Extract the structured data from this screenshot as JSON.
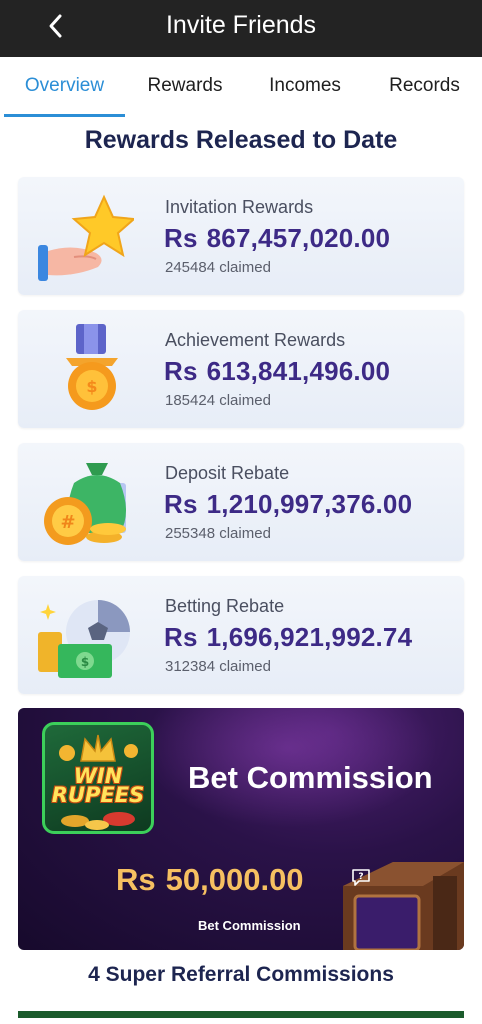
{
  "header": {
    "title": "Invite Friends"
  },
  "tabs": [
    {
      "label": "Overview",
      "active": true
    },
    {
      "label": "Rewards",
      "active": false
    },
    {
      "label": "Incomes",
      "active": false
    },
    {
      "label": "Records",
      "active": false
    }
  ],
  "section_title": "Rewards Released to Date",
  "cards": [
    {
      "label": "Invitation Rewards",
      "currency": "Rs",
      "amount": "867,457,020.00",
      "claimed": "245484 claimed",
      "icon": "star-hand-icon"
    },
    {
      "label": "Achievement Rewards",
      "currency": "Rs",
      "amount": "613,841,496.00",
      "claimed": "185424 claimed",
      "icon": "medal-icon"
    },
    {
      "label": "Deposit Rebate",
      "currency": "Rs",
      "amount": "1,210,997,376.00",
      "claimed": "255348 claimed",
      "icon": "money-bag-icon"
    },
    {
      "label": "Betting Rebate",
      "currency": "Rs",
      "amount": "1,696,921,992.74",
      "claimed": "312384 claimed",
      "icon": "soccer-cash-icon"
    }
  ],
  "banner": {
    "logo_text": "WIN RUPEES",
    "heading": "Bet Commission",
    "currency": "Rs",
    "amount": "50,000.00",
    "subtitle": "Bet Commission"
  },
  "footer_title": "4 Super Referral Commissions",
  "colors": {
    "accent": "#2b8ed6",
    "amount": "#3d2a86",
    "header_bg": "#232323",
    "banner_amount": "#f6c061"
  }
}
